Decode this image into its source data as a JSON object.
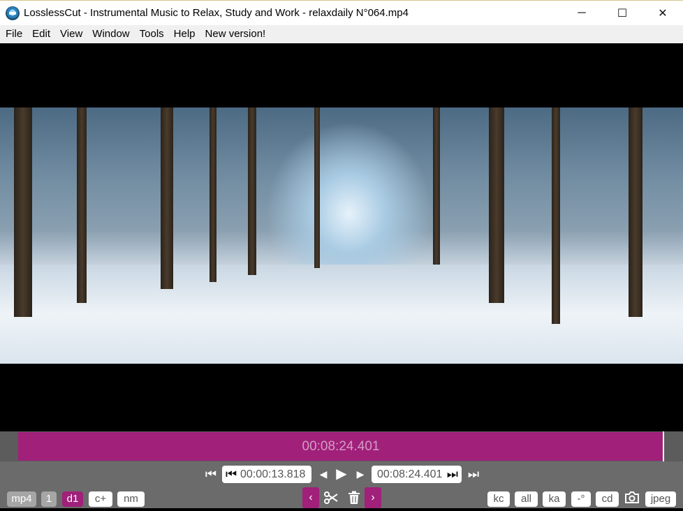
{
  "window": {
    "title": "LosslessCut - Instrumental Music to Relax, Study and Work - relaxdaily N°064.mp4",
    "controls": {
      "minimize": "─",
      "maximize": "☐",
      "close": "✕"
    }
  },
  "menu": {
    "items": [
      "File",
      "Edit",
      "View",
      "Window",
      "Tools",
      "Help",
      "New version!"
    ]
  },
  "timeline": {
    "current_time": "00:08:24.401",
    "segment_color": "#a0207a"
  },
  "playback": {
    "start_time": "00:00:13.818",
    "end_time": "00:08:24.401",
    "icons": {
      "jump_start": "⏮",
      "set_start": "⏮",
      "prev_frame": "◀",
      "play": "▶",
      "next_frame": "▶",
      "set_end": "⏭",
      "jump_end": "⏭"
    }
  },
  "bottom_left": {
    "format": "mp4",
    "stream_count": "1",
    "duration_mode": "d1",
    "cut_mode": "c+",
    "name_mode": "nm"
  },
  "bottom_center": {
    "prev_segment": "‹",
    "cut_icon": "scissors-icon",
    "delete_icon": "trash-icon",
    "next_segment": "›"
  },
  "bottom_right": {
    "keyframe_cut": "kc",
    "all_streams": "all",
    "keep_audio": "ka",
    "rotation": "-°",
    "cut_dir": "cd",
    "screenshot_format": "jpeg"
  }
}
